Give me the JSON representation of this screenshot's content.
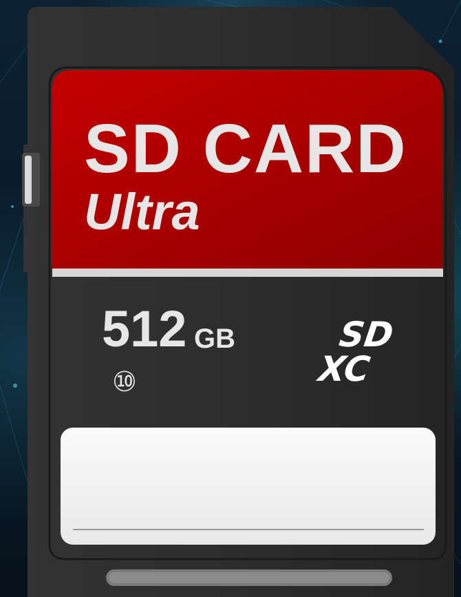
{
  "card": {
    "brand_line1": "SD CARD",
    "brand_line2": "Ultra",
    "capacity_number": "512",
    "capacity_unit": "GB",
    "speed_class": "⑩",
    "logo_top": "SD",
    "logo_bottom": "XC"
  },
  "colors": {
    "label_red": "#b00000",
    "card_body": "#2b2b2b",
    "text_light": "#e6e6e6",
    "write_area": "#f3f3f3",
    "background": "#08141f"
  },
  "icons": [
    "sd-card-icon",
    "sdxc-logo-icon",
    "speed-class-10-icon"
  ]
}
